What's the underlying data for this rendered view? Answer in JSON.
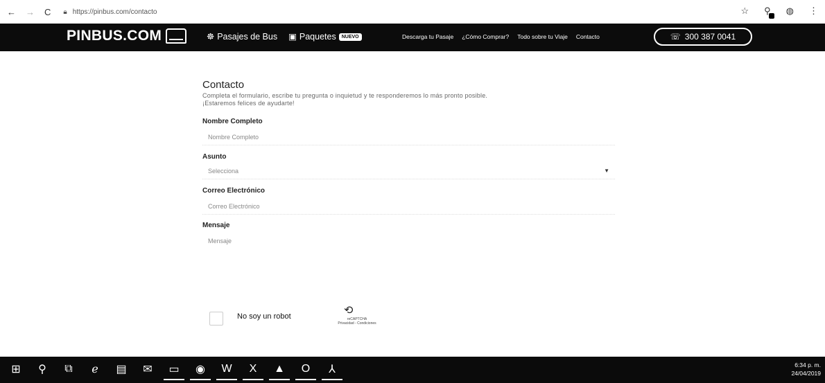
{
  "browser": {
    "back": "←",
    "forward": "→",
    "reload": "C",
    "url": "https://pinbus.com/contacto",
    "star_icon": "☆"
  },
  "header": {
    "logo_text": "PINBUS.COM",
    "nav_main": [
      {
        "icon": "☸",
        "label": "Pasajes de Bus"
      },
      {
        "icon": "▣",
        "label": "Paquetes",
        "badge": "NUEVO"
      }
    ],
    "nav_sub": [
      "Descarga tu Pasaje",
      "¿Cómo Comprar?",
      "Todo sobre tu Viaje",
      "Contacto"
    ],
    "phone": "300 387 0041"
  },
  "form": {
    "title": "Contacto",
    "intro_line1": "Completa el formulario, escribe tu pregunta o inquietud y te responderemos lo más pronto posible.",
    "intro_line2": "¡Estaremos felices de ayudarte!",
    "fields": {
      "name": {
        "label": "Nombre Completo",
        "placeholder": "Nombre Completo"
      },
      "subject": {
        "label": "Asunto",
        "placeholder": "Selecciona",
        "arrow": "▼"
      },
      "email": {
        "label": "Correo Electrónico",
        "placeholder": "Correo Electrónico"
      },
      "message": {
        "label": "Mensaje",
        "placeholder": "Mensaje"
      }
    },
    "captcha": {
      "label": "No soy un robot",
      "brand": "reCAPTCHA",
      "terms": "Privacidad - Condiciones"
    }
  },
  "taskbar": {
    "time": "6:34 p. m.",
    "date": "24/04/2019"
  }
}
